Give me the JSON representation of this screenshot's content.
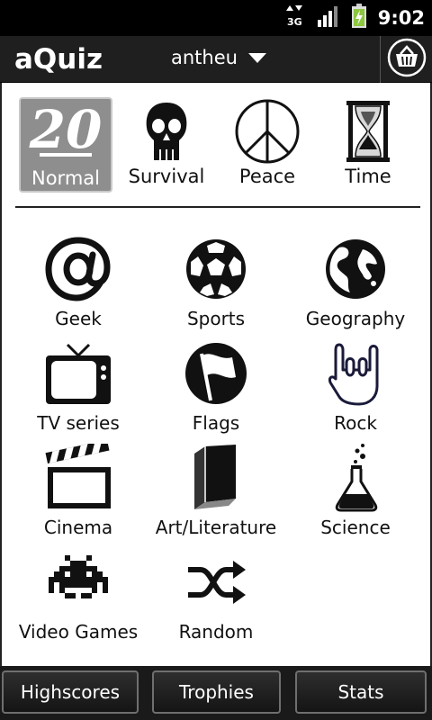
{
  "status": {
    "time": "9:02",
    "network": "3G"
  },
  "header": {
    "app_title": "aQuiz",
    "username": "antheu"
  },
  "modes": [
    {
      "label": "Normal",
      "count": "20",
      "icon": "number-20-icon",
      "selected": true
    },
    {
      "label": "Survival",
      "icon": "skull-icon"
    },
    {
      "label": "Peace",
      "icon": "peace-icon"
    },
    {
      "label": "Time",
      "icon": "hourglass-icon"
    }
  ],
  "categories": [
    {
      "label": "Geek",
      "icon": "at-sign-icon"
    },
    {
      "label": "Sports",
      "icon": "soccer-ball-icon"
    },
    {
      "label": "Geography",
      "icon": "globe-icon"
    },
    {
      "label": "TV series",
      "icon": "tv-icon"
    },
    {
      "label": "Flags",
      "icon": "flag-icon"
    },
    {
      "label": "Rock",
      "icon": "rock-hand-icon"
    },
    {
      "label": "Cinema",
      "icon": "clapperboard-icon"
    },
    {
      "label": "Art/Literature",
      "icon": "book-icon"
    },
    {
      "label": "Science",
      "icon": "flask-icon"
    },
    {
      "label": "Video Games",
      "icon": "space-invader-icon"
    },
    {
      "label": "Random",
      "icon": "shuffle-icon"
    }
  ],
  "footer": {
    "highscores": "Highscores",
    "trophies": "Trophies",
    "stats": "Stats"
  }
}
